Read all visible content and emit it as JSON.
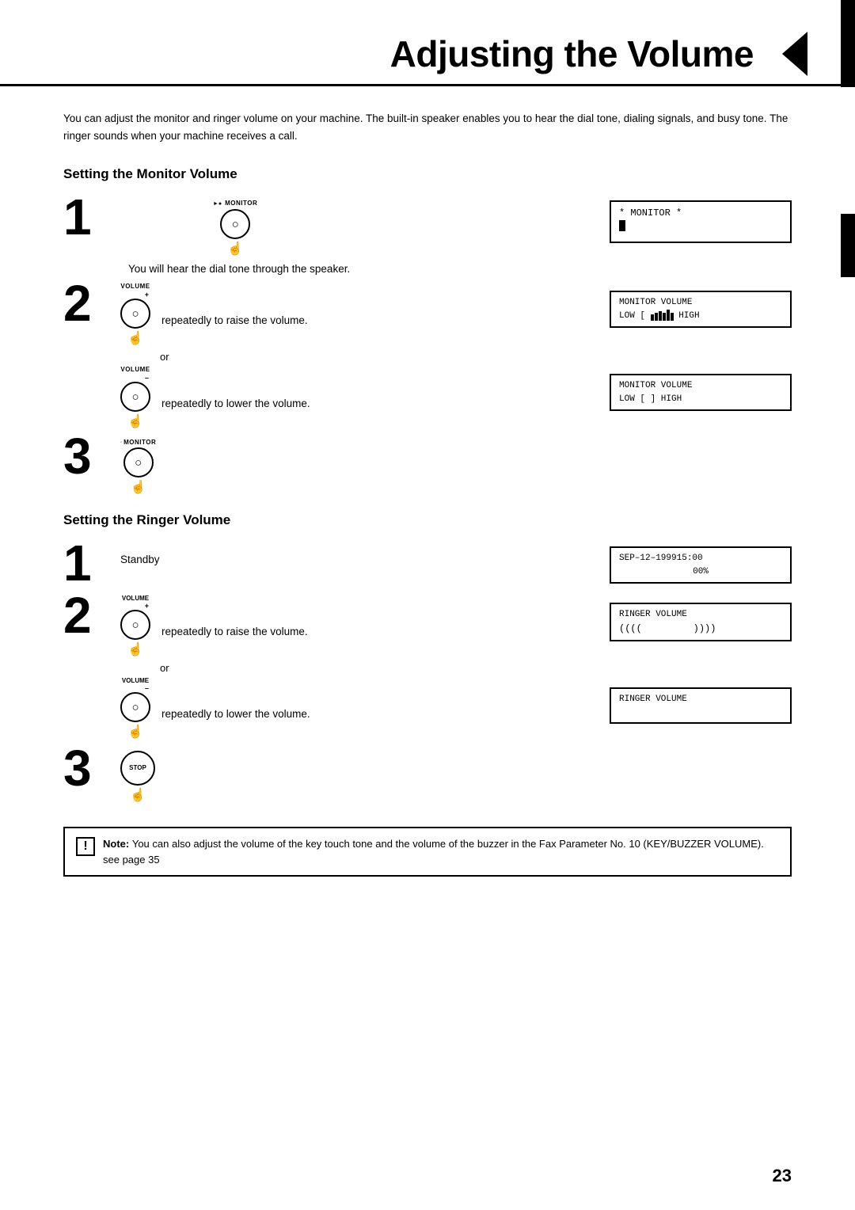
{
  "page": {
    "title": "Adjusting the Volume",
    "page_number": "23",
    "intro": "You can adjust the monitor and ringer volume on your machine. The built-in speaker enables you to hear the dial tone, dialing signals, and busy tone.  The ringer sounds when your machine receives a call."
  },
  "monitor_section": {
    "heading": "Setting the Monitor Volume",
    "step1": {
      "number": "1",
      "key_label": "MONITOR",
      "desc": "You will hear the dial tone through the speaker.",
      "lcd": "* MONITOR *"
    },
    "step2": {
      "number": "2",
      "key_label_up": "VOLUME",
      "key_label_down": "VOLUME",
      "desc_up": "repeatedly to raise the volume.",
      "or": "or",
      "desc_down": "repeatedly to lower the volume.",
      "lcd_up_line1": "MONITOR VOLUME",
      "lcd_up_line2": "LOW [  ▌▌▌▌▐▌  HIGH",
      "lcd_down_line1": "MONITOR VOLUME",
      "lcd_down_line2": "LOW [         ] HIGH"
    },
    "step3": {
      "number": "3",
      "key_label": "MONITOR"
    }
  },
  "ringer_section": {
    "heading": "Setting the Ringer Volume",
    "step1": {
      "number": "1",
      "desc": "Standby",
      "lcd_line1": "SEP–12–199915:00",
      "lcd_line2": "00%"
    },
    "step2": {
      "number": "2",
      "key_label_up": "VOLUME",
      "key_label_down": "VOLUME",
      "desc_up": "repeatedly to raise the volume.",
      "or": "or",
      "desc_down": "repeatedly to lower the volume.",
      "lcd_up_line1": "RINGER VOLUME",
      "lcd_up_line2": "((((         ))))",
      "lcd_down_line1": "RINGER VOLUME",
      "lcd_down_line2": ""
    },
    "step3": {
      "number": "3",
      "key_label": "STOP"
    }
  },
  "note": {
    "label": "Note:",
    "text": "You can also adjust the volume of the key touch tone and the volume of the buzzer in the Fax Parameter No. 10 (KEY/BUZZER VOLUME). see page 35"
  }
}
